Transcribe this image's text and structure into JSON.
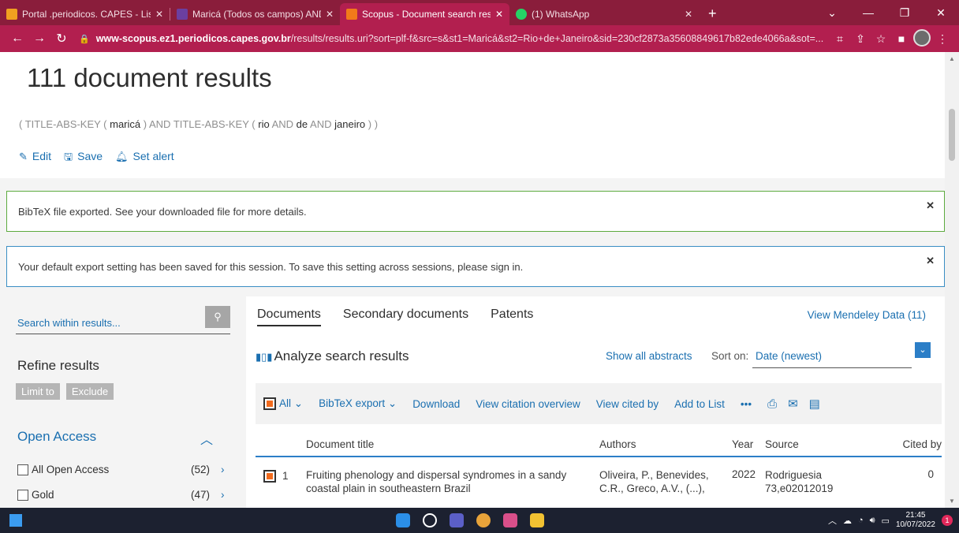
{
  "browser": {
    "tabs": [
      {
        "title": "Portal .periodicos. CAPES - Lista c",
        "active": false
      },
      {
        "title": "Maricá (Todos os campos) AND R",
        "active": false
      },
      {
        "title": "Scopus - Document search result",
        "active": true
      },
      {
        "title": "(1) WhatsApp",
        "active": false
      }
    ],
    "url_domain": "www-scopus.ez1.periodicos.capes.gov.br",
    "url_path": "/results/results.uri?sort=plf-f&src=s&st1=Maricá&st2=Rio+de+Janeiro&sid=230cf2873a35608849617b82ede4066a&sot=..."
  },
  "header": {
    "title": "111 document results",
    "query": {
      "open1": "( TITLE-ABS-KEY (",
      "term1": "maricá",
      "mid1": ") AND TITLE-ABS-KEY (",
      "term2": "rio",
      "and1": "AND",
      "term3": "de",
      "and2": "AND",
      "term4": "janeiro",
      "close": ") )"
    },
    "actions": {
      "edit": "Edit",
      "save": "Save",
      "alert": "Set alert"
    }
  },
  "alerts": {
    "bibtex": "BibTeX file exported. See your downloaded file for more details.",
    "export": "Your default export setting has been saved for this session. To save this setting across sessions, please sign in."
  },
  "sidebar": {
    "search_placeholder": "Search within results...",
    "refine": "Refine results",
    "limit": "Limit to",
    "exclude": "Exclude",
    "open_access": "Open Access",
    "facets": [
      {
        "label": "All Open Access",
        "count": "(52)"
      },
      {
        "label": "Gold",
        "count": "(47)"
      }
    ]
  },
  "main": {
    "tabs": [
      "Documents",
      "Secondary documents",
      "Patents"
    ],
    "mendeley": "View Mendeley Data (11)",
    "analyze": "Analyze search results",
    "show_abstracts": "Show all abstracts",
    "sort_label": "Sort on:",
    "sort_value": "Date (newest)",
    "toolbar": {
      "all": "All",
      "bibtex": "BibTeX export",
      "download": "Download",
      "citation": "View citation overview",
      "cited_by": "View cited by",
      "add_list": "Add to List",
      "more": "•••"
    },
    "columns": {
      "title": "Document title",
      "authors": "Authors",
      "year": "Year",
      "source": "Source",
      "cited": "Cited by"
    },
    "rows": [
      {
        "num": "1",
        "title": "Fruiting phenology and dispersal syndromes in a sandy coastal plain in southeastern Brazil",
        "authors": "Oliveira, P., Benevides, C.R., Greco, A.V., (...),",
        "year": "2022",
        "source1": "Rodriguesia",
        "source2": "73,e02012019",
        "cited": "0"
      }
    ]
  },
  "taskbar": {
    "time": "21:45",
    "date": "10/07/2022",
    "notifications": "1"
  }
}
